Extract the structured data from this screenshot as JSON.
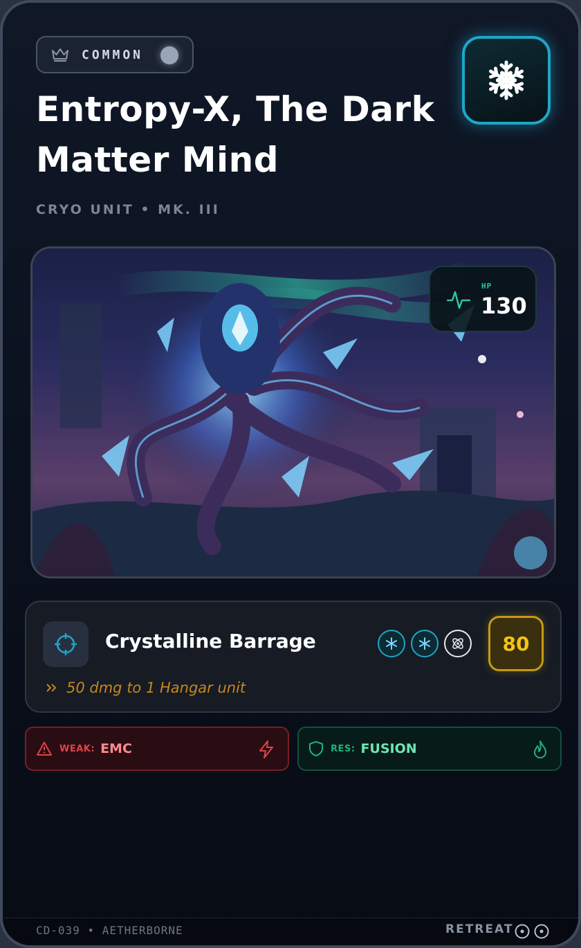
{
  "card": {
    "rarity": {
      "label": "COMMON",
      "icon": "crown-icon"
    },
    "element": {
      "icon": "snowflake-icon",
      "accent": "#1fa6c6"
    },
    "name": "Entropy-X, The Dark Matter Mind",
    "subtitle": "CRYO UNIT • MK. III",
    "artwork": {
      "icon": "creature-artwork"
    },
    "hp": {
      "label": "HP",
      "value": "130",
      "icon": "pulse-icon",
      "accent": "#2ec4a4"
    }
  },
  "attack": {
    "icon": "crosshair-icon",
    "name": "Crystalline Barrage",
    "costs": [
      "cryo",
      "cryo",
      "neutral"
    ],
    "damage": "80",
    "effect": "50 dmg to 1 Hangar unit",
    "damage_color": "#f3c31a"
  },
  "weakness": {
    "key": "WEAK:",
    "value": "EMC",
    "icon": "warning-icon",
    "type_icon": "lightning-icon",
    "color": "#e0424a"
  },
  "resistance": {
    "key": "RES:",
    "value": "FUSION",
    "icon": "shield-icon",
    "type_icon": "flame-icon",
    "color": "#22b07c"
  },
  "footer": {
    "code": "CD-039 • AETHERBORNE",
    "retreat_label": "RETREAT",
    "retreat_cost": 2
  }
}
